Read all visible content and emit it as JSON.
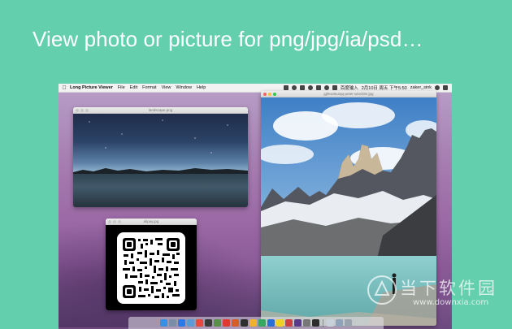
{
  "headline": "View photo or picture for png/jpg/ia/psd…",
  "menubar": {
    "app_name": "Long Picture Viewer",
    "items": [
      "File",
      "Edit",
      "Format",
      "View",
      "Window",
      "Help"
    ],
    "status_text": "百度输入",
    "datetime": "2月10日 周五 下午5:50",
    "user": "zaker_sink"
  },
  "windows": {
    "landscape": {
      "title": "landscape.png"
    },
    "qr": {
      "title": "alipay.jpg"
    },
    "mountain": {
      "title": "jgl9oo8u2qq-peter-winckler.jpg"
    }
  },
  "watermark": {
    "brand": "当下软件园",
    "url": "www.downxia.com"
  },
  "colors": {
    "background": "#63cfad",
    "headline": "#ffffff"
  }
}
